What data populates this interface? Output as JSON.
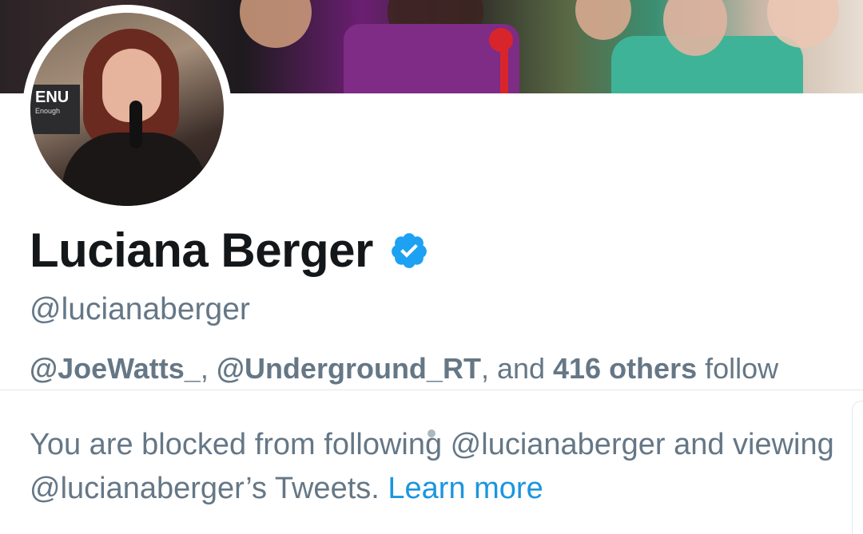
{
  "profile": {
    "display_name": "Luciana Berger",
    "handle": "@lucianaberger",
    "verified_icon": "verified-badge-icon",
    "avatar_sign_text": "ENU",
    "avatar_sign_subtext": "Enough"
  },
  "followed_by": {
    "user1": "@JoeWatts_",
    "sep1": ", ",
    "user2": "@Underground_RT",
    "sep2": ", and ",
    "others": "416 others",
    "suffix": " follow"
  },
  "blocked_notice": {
    "text": "You are blocked from following @lucianaberger and viewing @lucianaberger’s Tweets.",
    "link_label": "Learn more"
  },
  "colors": {
    "name": "#14171a",
    "secondary": "#657786",
    "link": "#1b95e0",
    "verified": "#1da1f2",
    "divider": "#e1e8ed"
  }
}
